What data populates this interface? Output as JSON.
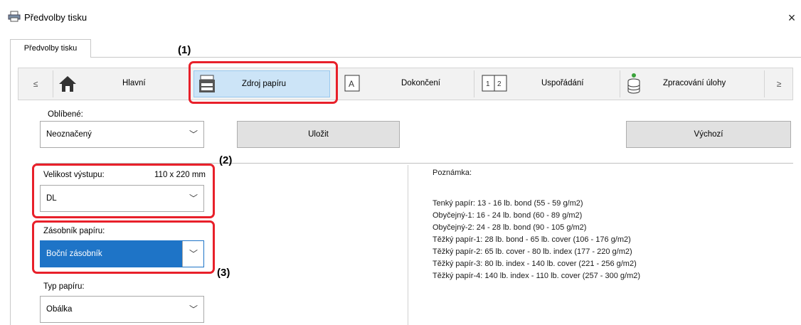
{
  "window": {
    "title": "Předvolby tisku",
    "close": "×"
  },
  "tab": {
    "label": "Předvolby tisku"
  },
  "toolbar": {
    "prev": "≤",
    "next": "≥",
    "items": [
      {
        "label": "Hlavní"
      },
      {
        "label": "Zdroj papíru"
      },
      {
        "label": "Dokončení"
      },
      {
        "label": "Uspořádání"
      },
      {
        "label": "Zpracování úlohy"
      }
    ]
  },
  "annotations": {
    "a1": "(1)",
    "a2": "(2)",
    "a3": "(3)"
  },
  "favorites": {
    "label": "Oblíbené:",
    "value": "Neoznačený",
    "save": "Uložit",
    "default": "Výchozí"
  },
  "output_size": {
    "label": "Velikost výstupu:",
    "dims": "110 x 220 mm",
    "value": "DL"
  },
  "tray": {
    "label": "Zásobník papíru:",
    "value": "Boční zásobník"
  },
  "paper_type": {
    "label": "Typ papíru:",
    "value": "Obálka"
  },
  "note": {
    "title": "Poznámka:",
    "lines": [
      "Tenký papír: 13 - 16 lb. bond (55 - 59 g/m2)",
      "Obyčejný-1: 16 - 24 lb. bond (60 - 89 g/m2)",
      "Obyčejný-2: 24 - 28 lb. bond (90 - 105 g/m2)",
      "Těžký papír-1: 28 lb. bond - 65 lb. cover (106 - 176 g/m2)",
      "Těžký papír-2: 65 lb. cover - 80 lb. index (177 - 220 g/m2)",
      "Těžký papír-3: 80 lb. index - 140 lb. cover (221 - 256 g/m2)",
      "Těžký papír-4: 140 lb. index - 110 lb. cover (257 - 300 g/m2)"
    ]
  },
  "colors": {
    "accent": "#1e74c7",
    "highlight": "#e8202a",
    "selected_tab": "#cce4f7"
  }
}
